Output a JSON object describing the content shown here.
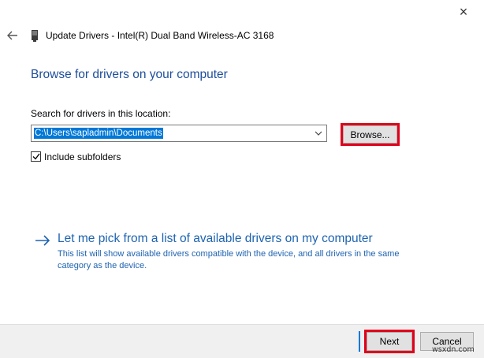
{
  "window": {
    "close_glyph": "×",
    "title": "Update Drivers - Intel(R) Dual Band Wireless-AC 3168",
    "back_icon": "back-arrow-icon",
    "device_icon": "network-adapter-icon"
  },
  "main": {
    "heading": "Browse for drivers on your computer",
    "search_label": "Search for drivers in this location:",
    "path_value": "C:\\Users\\sapladmin\\Documents",
    "browse_label": "Browse...",
    "include_subfolders": {
      "label": "Include subfolders",
      "checked": true
    },
    "pick_link": {
      "title": "Let me pick from a list of available drivers on my computer",
      "description": "This list will show available drivers compatible with the device, and all drivers in the same category as the device."
    }
  },
  "footer": {
    "next_label": "Next",
    "cancel_label": "Cancel",
    "watermark": "wsxdn.com"
  },
  "colors": {
    "heading": "#1e4e9b",
    "link": "#1e63b0",
    "selection": "#0078d7",
    "highlight_box": "#e0001a",
    "footer_bg": "#f0f0f0"
  }
}
